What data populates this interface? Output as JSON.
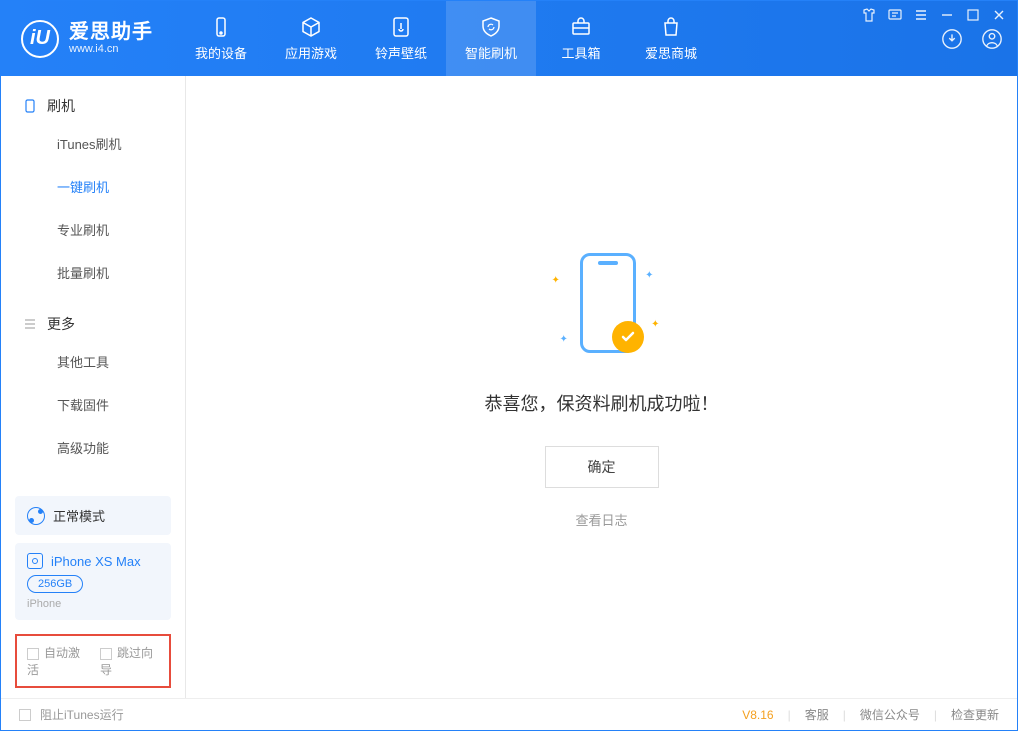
{
  "app": {
    "name": "爱思助手",
    "domain": "www.i4.cn"
  },
  "tabs": [
    {
      "label": "我的设备"
    },
    {
      "label": "应用游戏"
    },
    {
      "label": "铃声壁纸"
    },
    {
      "label": "智能刷机"
    },
    {
      "label": "工具箱"
    },
    {
      "label": "爱思商城"
    }
  ],
  "sidebar": {
    "group1": {
      "label": "刷机"
    },
    "items1": [
      {
        "label": "iTunes刷机"
      },
      {
        "label": "一键刷机"
      },
      {
        "label": "专业刷机"
      },
      {
        "label": "批量刷机"
      }
    ],
    "group2": {
      "label": "更多"
    },
    "items2": [
      {
        "label": "其他工具"
      },
      {
        "label": "下载固件"
      },
      {
        "label": "高级功能"
      }
    ]
  },
  "mode": {
    "label": "正常模式"
  },
  "device": {
    "name": "iPhone XS Max",
    "storage": "256GB",
    "type": "iPhone"
  },
  "highlight": {
    "opt1": "自动激活",
    "opt2": "跳过向导"
  },
  "main": {
    "success_text": "恭喜您，保资料刷机成功啦！",
    "ok_button": "确定",
    "log_link": "查看日志"
  },
  "footer": {
    "block_itunes": "阻止iTunes运行",
    "version": "V8.16",
    "link1": "客服",
    "link2": "微信公众号",
    "link3": "检查更新"
  }
}
